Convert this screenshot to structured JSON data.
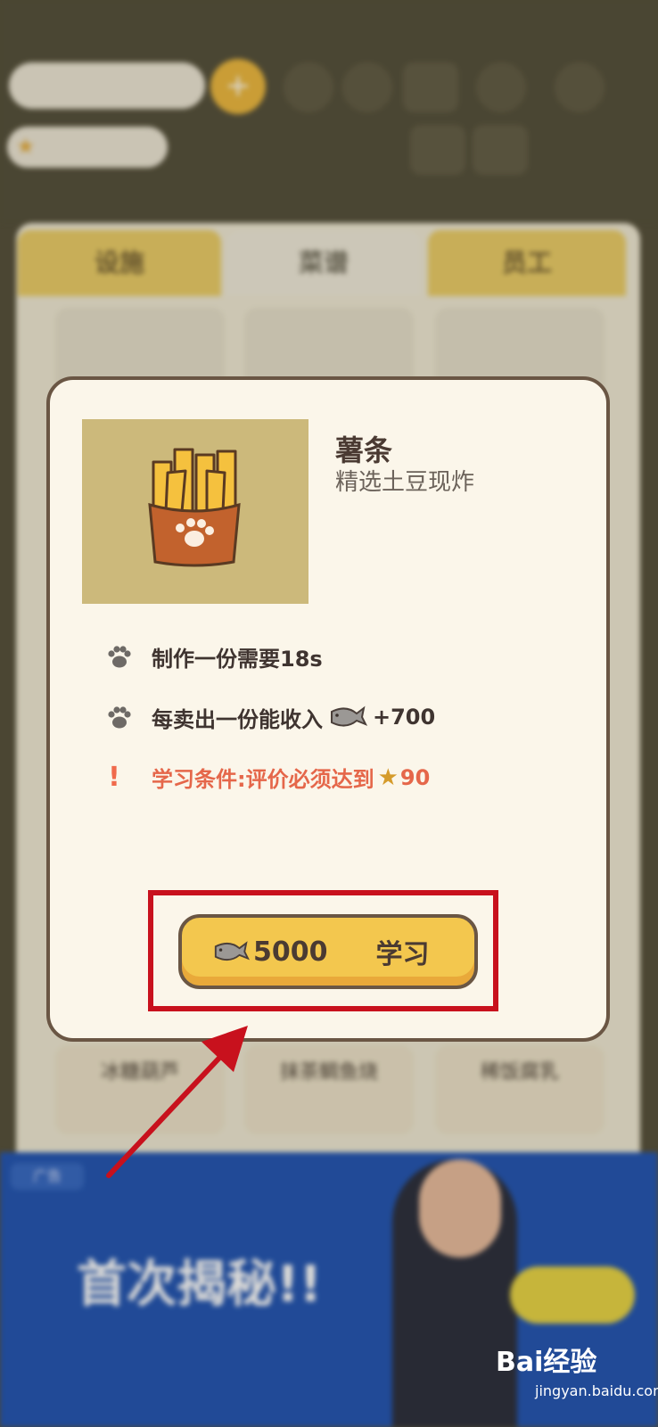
{
  "background": {
    "search_text": "",
    "rating_text": "",
    "tabs": [
      "设施",
      "菜谱",
      "员工"
    ],
    "bottom_cards": [
      "冰糖葫芦",
      "抹茶鲷鱼烧",
      "稀饭腐乳"
    ]
  },
  "modal": {
    "title": "薯条",
    "subtitle": "精选土豆现炸",
    "time_text": "制作一份需要18s",
    "income_text": "每卖出一份能收入",
    "income_value": "+700",
    "condition_text": "学习条件:评价必须达到",
    "condition_value": "90",
    "cost": "5000",
    "learn_label": "学习"
  },
  "ad": {
    "tag": "广告",
    "headline": "首次揭秘!!"
  },
  "watermark": {
    "brand": "Bai经验",
    "url": "jingyan.baidu.com"
  },
  "colors": {
    "accent_yellow": "#f3c74e",
    "alert_red": "#e5674a",
    "highlight_red": "#c8111d",
    "modal_bg": "#fbf6ea"
  },
  "icons": [
    "paw-icon",
    "fish-icon",
    "star-icon",
    "exclamation-icon"
  ]
}
